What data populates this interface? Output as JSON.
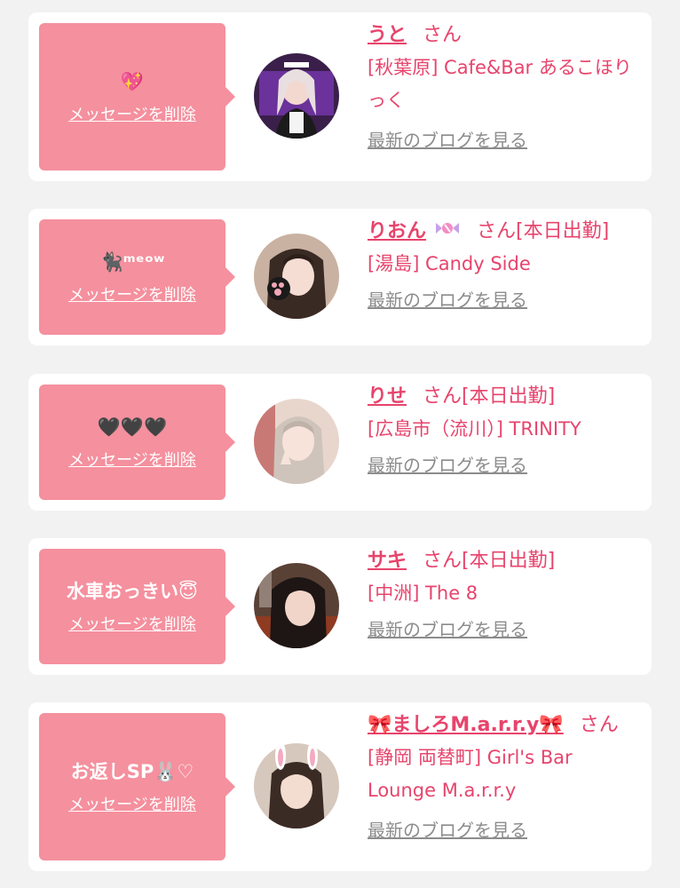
{
  "delete_label": "メッセージを削除",
  "blog_label": "最新のブログを見る",
  "san_label": "さん",
  "messages": [
    {
      "text": "💖",
      "name": "うと",
      "status": "",
      "shop": "[秋葉原] Cafe&Bar あるこほりっく"
    },
    {
      "text": "🐈‍⬛ᵐᵉᵒʷ",
      "name": "りおん",
      "status": "[本日出勤]",
      "shop": "[湯島] Candy Side"
    },
    {
      "text": "🖤🖤🖤",
      "name": "りせ",
      "status": "[本日出勤]",
      "shop": "[広島市（流川）] TRINITY"
    },
    {
      "text": "水車おっきい😇",
      "name": "サキ",
      "status": "[本日出勤]",
      "shop": "[中洲] The 8"
    },
    {
      "text": "お返しSP🐰♡",
      "name": "🎀ましろM.a.r.r.y🎀",
      "status": "",
      "shop": "[静岡 両替町] Girl's Bar Lounge M.a.r.r.y"
    }
  ],
  "colors": {
    "accent": "#e7446c",
    "bubble": "#f5909e",
    "link_gray": "#8c8c8c"
  }
}
